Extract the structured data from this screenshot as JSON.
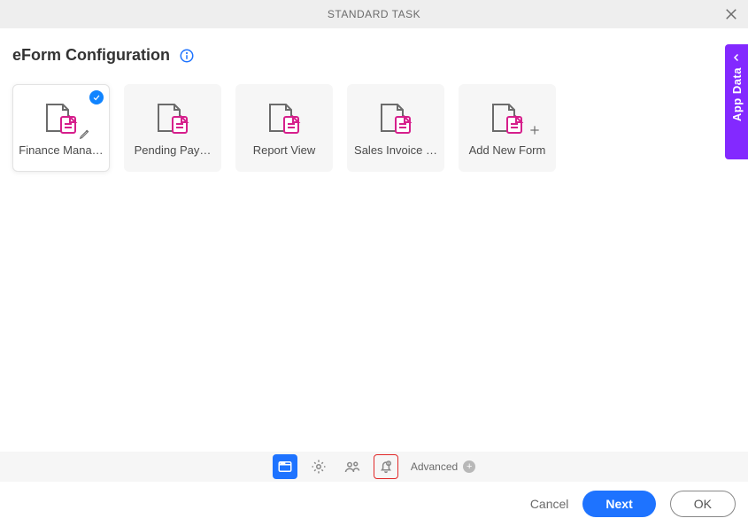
{
  "header": {
    "title": "STANDARD TASK"
  },
  "page": {
    "title": "eForm Configuration"
  },
  "cards": [
    {
      "label": "Finance Mana…"
    },
    {
      "label": "Pending Pay…"
    },
    {
      "label": "Report View"
    },
    {
      "label": "Sales Invoice …"
    },
    {
      "label": "Add New Form"
    }
  ],
  "sideTab": {
    "label": "App Data"
  },
  "toolbar": {
    "advanced_label": "Advanced"
  },
  "footer": {
    "cancel": "Cancel",
    "next": "Next",
    "ok": "OK"
  }
}
